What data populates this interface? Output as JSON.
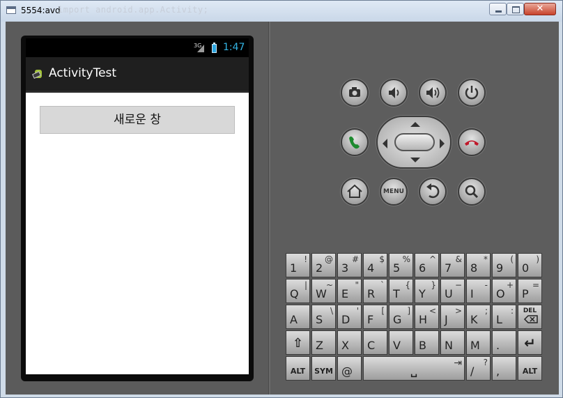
{
  "window": {
    "title": "5554:avd",
    "faint_text": "import android.app.Activity;"
  },
  "status_bar": {
    "network": "3G",
    "time": "1:47"
  },
  "app": {
    "title": "ActivityTest",
    "button_label": "새로운 창"
  },
  "hardware": {
    "menu_label": "MENU"
  },
  "keyboard": {
    "rows": [
      [
        {
          "m": "1",
          "s": "!"
        },
        {
          "m": "2",
          "s": "@"
        },
        {
          "m": "3",
          "s": "#"
        },
        {
          "m": "4",
          "s": "$"
        },
        {
          "m": "5",
          "s": "%"
        },
        {
          "m": "6",
          "s": "^"
        },
        {
          "m": "7",
          "s": "&"
        },
        {
          "m": "8",
          "s": "*"
        },
        {
          "m": "9",
          "s": "("
        },
        {
          "m": "0",
          "s": ")"
        }
      ],
      [
        {
          "m": "Q",
          "s": "|"
        },
        {
          "m": "W",
          "s": "~"
        },
        {
          "m": "E",
          "s": "\""
        },
        {
          "m": "R",
          "s": "`"
        },
        {
          "m": "T",
          "s": "{"
        },
        {
          "m": "Y",
          "s": "}"
        },
        {
          "m": "U",
          "s": "−"
        },
        {
          "m": "I",
          "s": "-"
        },
        {
          "m": "O",
          "s": "+"
        },
        {
          "m": "P",
          "s": "="
        }
      ],
      [
        {
          "m": "A",
          "s": ""
        },
        {
          "m": "S",
          "s": "\\"
        },
        {
          "m": "D",
          "s": "'"
        },
        {
          "m": "F",
          "s": "["
        },
        {
          "m": "G",
          "s": "]"
        },
        {
          "m": "H",
          "s": "<"
        },
        {
          "m": "J",
          "s": ">"
        },
        {
          "m": "K",
          "s": ";"
        },
        {
          "m": "L",
          "s": ":"
        },
        {
          "m": "",
          "s": "",
          "label": "DEL"
        }
      ],
      [
        {
          "m": "",
          "s": "",
          "label": "⇧"
        },
        {
          "m": "Z",
          "s": ""
        },
        {
          "m": "X",
          "s": ""
        },
        {
          "m": "C",
          "s": ""
        },
        {
          "m": "V",
          "s": ""
        },
        {
          "m": "B",
          "s": ""
        },
        {
          "m": "N",
          "s": ""
        },
        {
          "m": "M",
          "s": ""
        },
        {
          "m": ".",
          "s": ""
        },
        {
          "m": "",
          "s": "",
          "label": "↵"
        }
      ],
      [
        {
          "m": "",
          "s": "",
          "label": "ALT"
        },
        {
          "m": "",
          "s": "",
          "label": "SYM"
        },
        {
          "m": "@",
          "s": ""
        },
        {
          "m": "",
          "s": "",
          "label": "␣"
        },
        {
          "m": "/",
          "s": "?"
        },
        {
          "m": ",",
          "s": ""
        },
        {
          "m": "",
          "s": "",
          "label": "ALT"
        }
      ]
    ]
  }
}
